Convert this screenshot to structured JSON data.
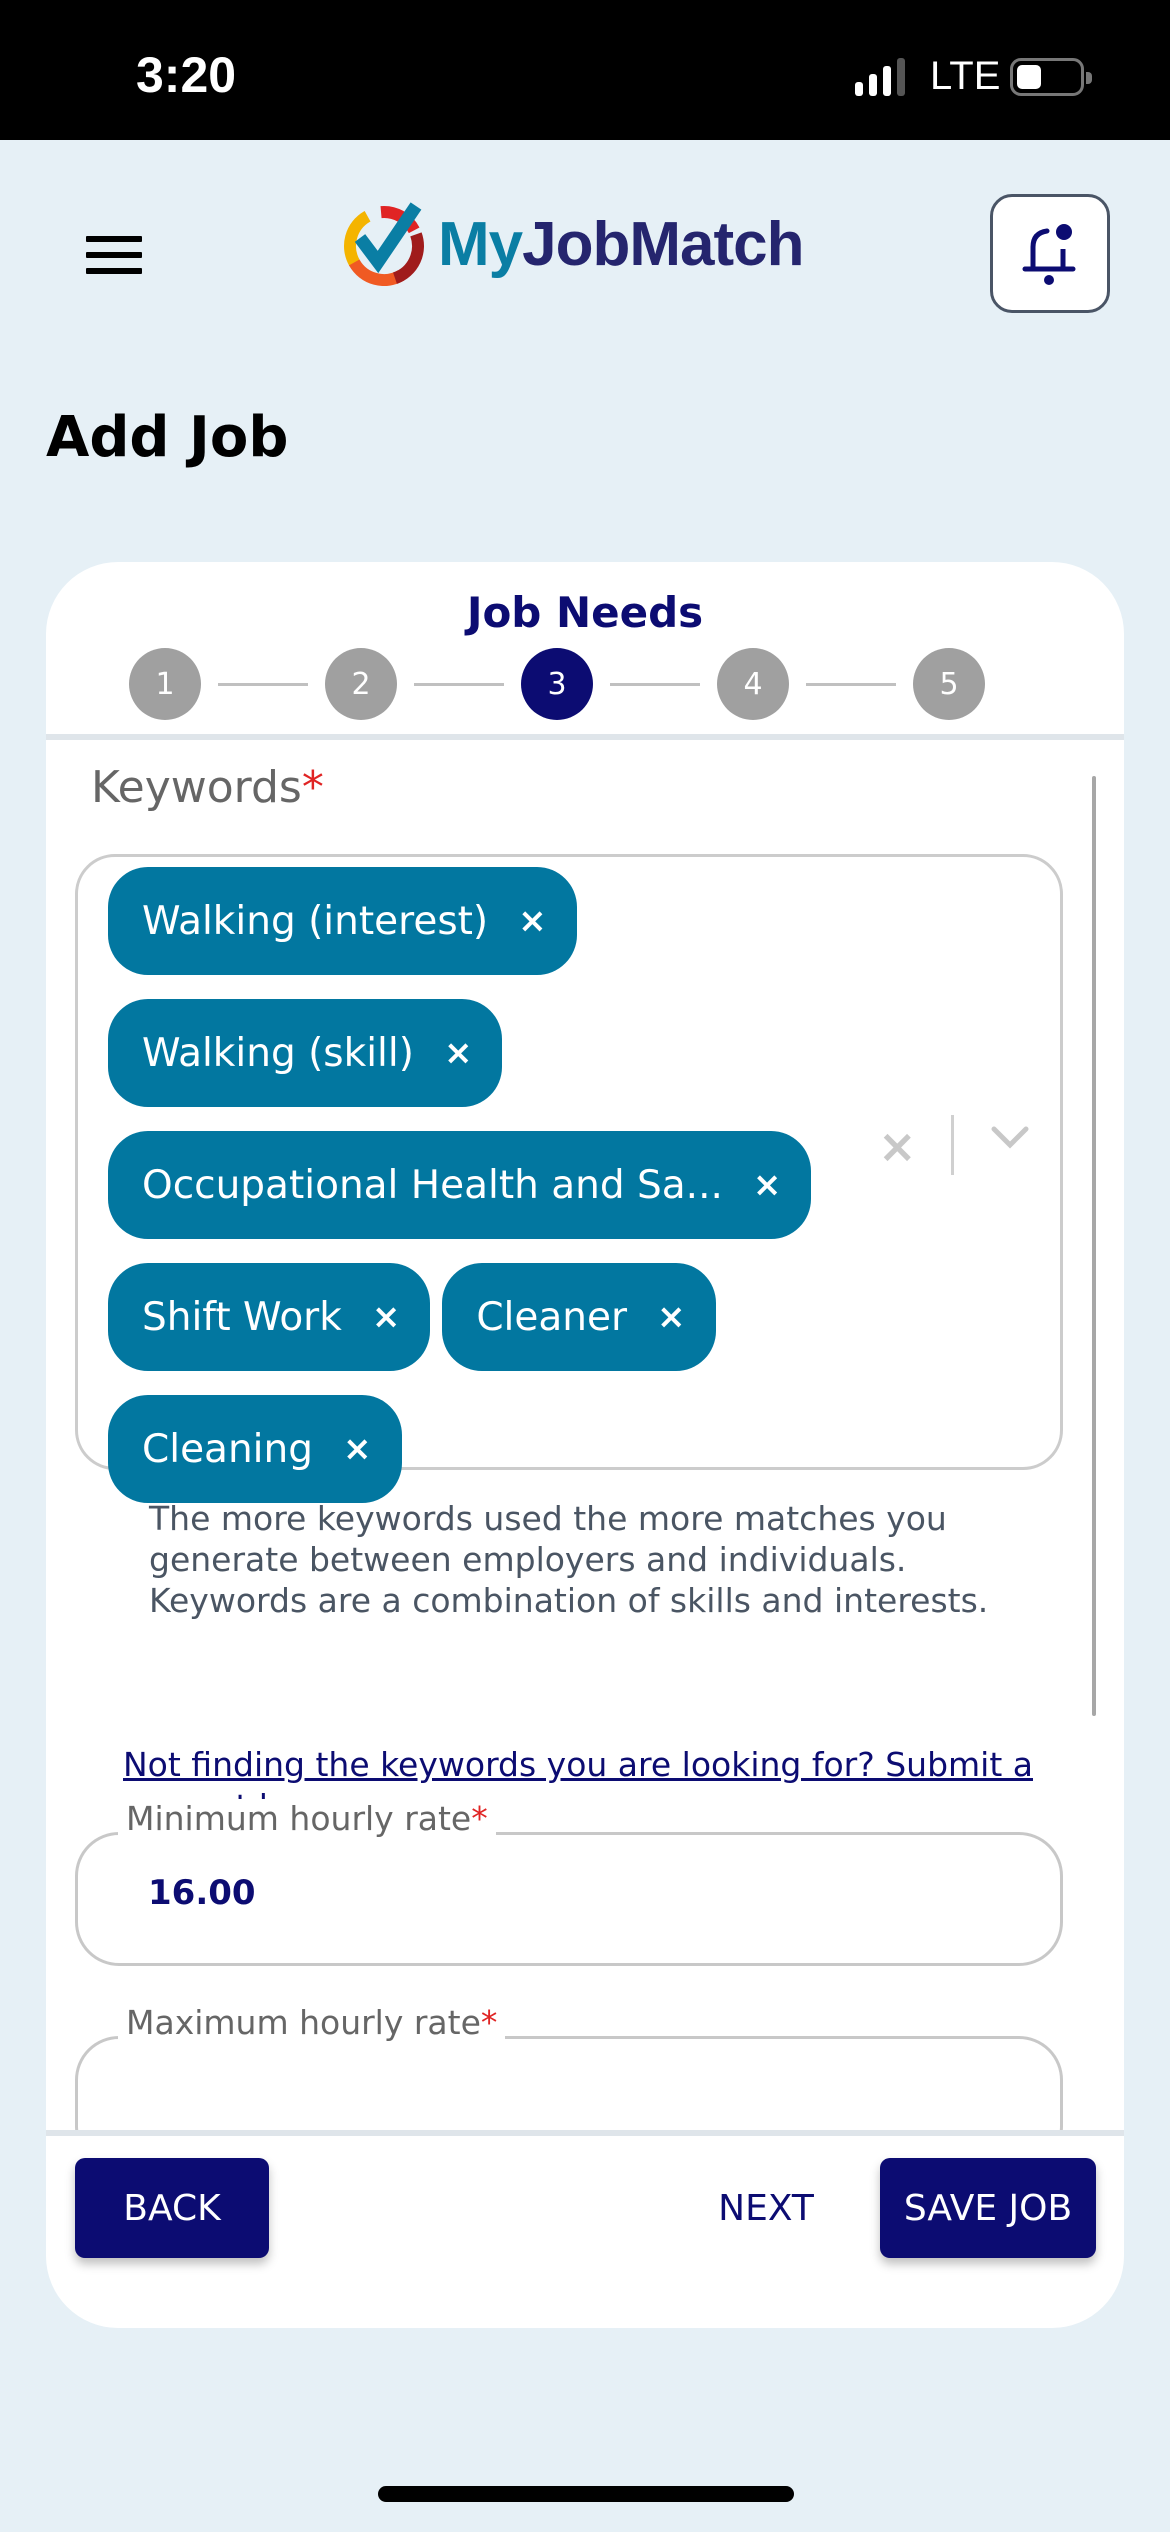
{
  "status_bar": {
    "time": "3:20",
    "network": "LTE",
    "signal_bars": 3,
    "signal_bars_total": 4,
    "battery_level": 0.35
  },
  "header": {
    "menu_icon": "hamburger-menu-icon",
    "logo": {
      "part1": "My",
      "part2": "JobMatch"
    },
    "notification_icon": "bell-notification-icon"
  },
  "page": {
    "title": "Add Job"
  },
  "wizard": {
    "title": "Job Needs",
    "steps": [
      "1",
      "2",
      "3",
      "4",
      "5"
    ],
    "current_step": 3
  },
  "keywords": {
    "label": "Keywords",
    "required_marker": "*",
    "chips": [
      {
        "label": "Walking (interest)",
        "remove": "×"
      },
      {
        "label": "Walking (skill)",
        "remove": "×"
      },
      {
        "label": "Occupational Health and Sa...",
        "remove": "×"
      },
      {
        "label": "Shift Work",
        "remove": "×"
      },
      {
        "label": "Cleaner",
        "remove": "×"
      },
      {
        "label": "Cleaning",
        "remove": "×"
      }
    ],
    "clear_all": "×",
    "help_text": "The more keywords used the more matches you generate between employers and individuals. Keywords are a combination of skills and interests.",
    "request_link": "Not finding the keywords you are looking for? Submit a request here."
  },
  "fields": {
    "min_rate": {
      "label": "Minimum hourly rate",
      "required_marker": "*",
      "value": "16.00"
    },
    "max_rate": {
      "label": "Maximum hourly rate",
      "required_marker": "*",
      "value": ""
    }
  },
  "actions": {
    "back": "BACK",
    "next": "NEXT",
    "save": "SAVE JOB"
  },
  "colors": {
    "primary": "#0c0c72",
    "chip": "#0277a0",
    "background": "#e6f0f6",
    "required": "#e02424"
  }
}
